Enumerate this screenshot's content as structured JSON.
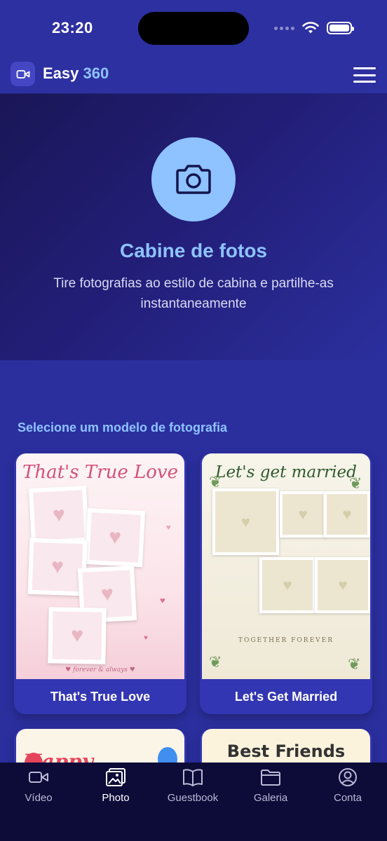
{
  "status": {
    "time": "23:20"
  },
  "header": {
    "brand_main": "Easy",
    "brand_accent": "360",
    "logo_icon": "video-camera-icon",
    "menu_icon": "hamburger-menu-icon"
  },
  "hero": {
    "icon": "camera-icon",
    "title": "Cabine de fotos",
    "subtitle": "Tire fotografias ao estilo de cabina e partilhe-as instantaneamente"
  },
  "section": {
    "title": "Selecione um modelo de fotografia"
  },
  "templates": [
    {
      "label": "That's True Love",
      "thumb_title": "That's True Love",
      "thumb_footer": "♥ forever & always ♥"
    },
    {
      "label": "Let's Get Married",
      "thumb_title": "Let's get married",
      "thumb_footer": "TOGETHER FOREVER"
    },
    {
      "thumb_title": "Happy Birthday"
    },
    {
      "thumb_title": "Best Friends"
    }
  ],
  "tabs": [
    {
      "label": "Vídeo",
      "icon": "video-icon",
      "active": false
    },
    {
      "label": "Photo",
      "icon": "photo-icon",
      "active": true
    },
    {
      "label": "Guestbook",
      "icon": "book-icon",
      "active": false
    },
    {
      "label": "Galeria",
      "icon": "folder-icon",
      "active": false
    },
    {
      "label": "Conta",
      "icon": "account-icon",
      "active": false
    }
  ],
  "colors": {
    "accent": "#8ec3ff",
    "background": "#2b2f9e",
    "tabbar": "#0d0b38"
  }
}
